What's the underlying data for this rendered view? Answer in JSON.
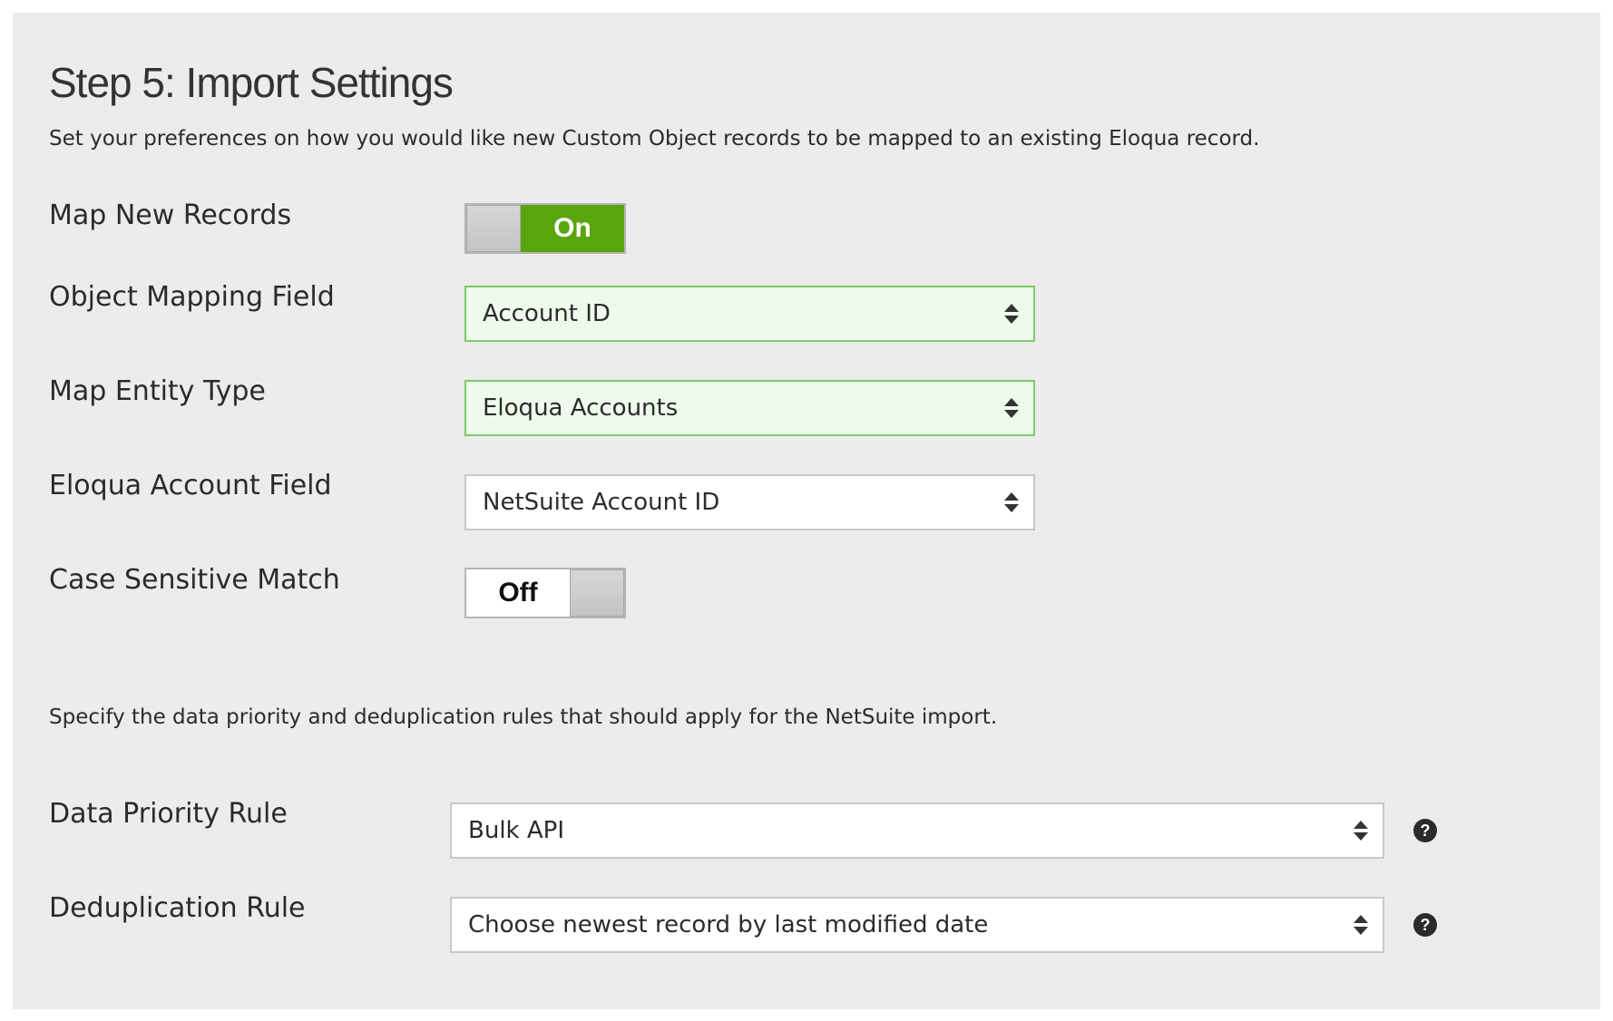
{
  "page": {
    "title": "Step 5: Import Settings",
    "description": "Set your preferences on how you would like new Custom Object records to be mapped to an existing Eloqua record.",
    "dedup_description": "Specify the data priority and deduplication rules that should apply for the NetSuite import."
  },
  "fields": {
    "map_new_records": {
      "label": "Map New Records",
      "state": "On"
    },
    "object_mapping_field": {
      "label": "Object Mapping Field",
      "value": "Account ID"
    },
    "map_entity_type": {
      "label": "Map Entity Type",
      "value": "Eloqua Accounts"
    },
    "eloqua_account_field": {
      "label": "Eloqua Account Field",
      "value": "NetSuite Account ID"
    },
    "case_sensitive_match": {
      "label": "Case Sensitive Match",
      "state": "Off"
    },
    "data_priority_rule": {
      "label": "Data Priority Rule",
      "value": "Bulk API",
      "help": "?"
    },
    "deduplication_rule": {
      "label": "Deduplication Rule",
      "value": "Choose newest record by last modified date",
      "help": "?"
    }
  },
  "colors": {
    "toggle_on": "#5aa50d",
    "valid_select_bg": "#eefbec",
    "valid_select_border": "#7ccb6a",
    "panel_bg": "#ececec"
  },
  "icons": {
    "select_arrows": "up-down-caret-icon",
    "help": "question-circle-icon"
  }
}
